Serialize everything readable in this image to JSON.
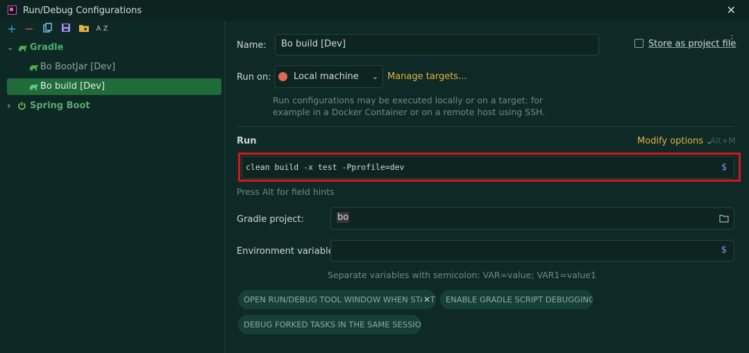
{
  "window": {
    "title": "Run/Debug Configurations",
    "close_glyph": "✕"
  },
  "toolbar": {
    "add": "+",
    "remove": "−",
    "copy_icon": "copy-icon",
    "save_icon": "save-icon",
    "folder_icon": "new-folder-icon",
    "sort_label": "A Z"
  },
  "tree": {
    "gradle": {
      "label": "Gradle",
      "chevron": "⌄"
    },
    "items": [
      {
        "label": "Bo BootJar [Dev]"
      },
      {
        "label": "Bo build [Dev]"
      }
    ],
    "spring": {
      "label": "Spring Boot",
      "chevron": "›"
    }
  },
  "form": {
    "name_label": "Name:",
    "name_value": "Bo build [Dev]",
    "store_label": "Store as project file",
    "runon_label": "Run on:",
    "runon_value": "Local machine",
    "manage_targets": "Manage targets...",
    "runon_hint_1": "Run configurations may be executed locally or on a target: for",
    "runon_hint_2": "example in a Docker Container or on a remote host using SSH.",
    "run_section": "Run",
    "modify_options": "Modify options",
    "modify_shortcut": "Alt+M",
    "run_command": "clean build -x test -Pprofile=dev",
    "dollar": "$",
    "field_hint": "Press Alt for field hints",
    "gradle_project_label": "Gradle project:",
    "gradle_project_value": "bo",
    "env_label": "Environment variables:",
    "env_hint": "Separate variables with semicolon: VAR=value; VAR1=value1"
  },
  "chips": [
    {
      "label": "OPEN RUN/DEBUG TOOL WINDOW WHEN STARTED"
    },
    {
      "label": "ENABLE GRADLE SCRIPT DEBUGGING"
    },
    {
      "label": "DEBUG FORKED TASKS IN THE SAME SESSION"
    }
  ],
  "colors": {
    "accent_green": "#1f6b3a",
    "highlight_red": "#d8141c",
    "link_yellow": "#e3b341",
    "dollar_purple": "#9a8cf0"
  }
}
